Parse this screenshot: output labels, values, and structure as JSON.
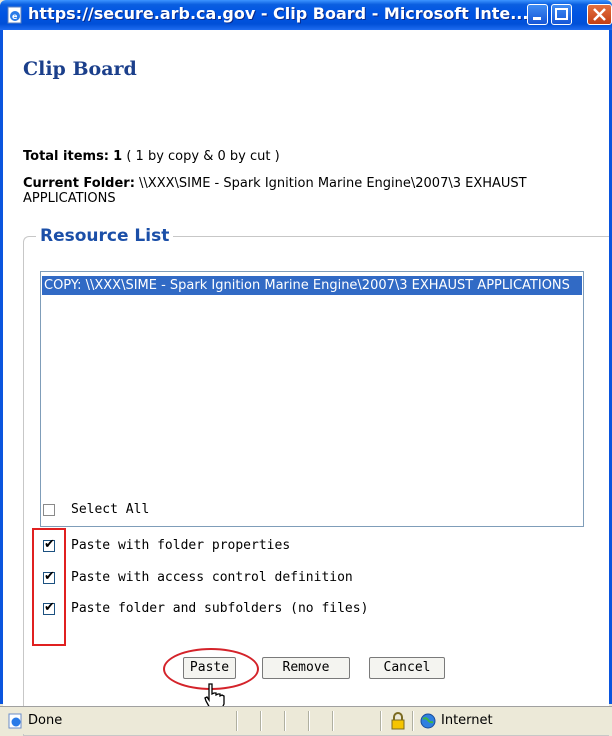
{
  "window": {
    "title": "https://secure.arb.ca.gov - Clip Board - Microsoft Inte...",
    "title_color": "#0054e3"
  },
  "page": {
    "title": "Clip Board",
    "total_label": "Total items:",
    "total_value": "1",
    "total_detail": " ( 1 by copy & 0 by cut )",
    "folder_label": "Current Folder:",
    "folder_path": " \\\\XXX\\SIME - Spark Ignition Marine Engine\\2007\\3 EXHAUST APPLICATIONS"
  },
  "resource_list": {
    "legend": "Resource List",
    "items": [
      "COPY:  \\\\XXX\\SIME - Spark Ignition Marine Engine\\2007\\3 EXHAUST APPLICATIONS"
    ],
    "selected_color": "#316ac5"
  },
  "options": {
    "select_all": {
      "label": "Select All",
      "checked": false
    },
    "paste_folder_properties": {
      "label": "Paste with folder properties",
      "checked": true
    },
    "paste_access_control": {
      "label": "Paste with access control definition",
      "checked": true
    },
    "paste_subfolders": {
      "label": "Paste folder and subfolders (no files)",
      "checked": true
    }
  },
  "buttons": {
    "paste": "Paste",
    "remove": "Remove",
    "cancel": "Cancel"
  },
  "annotations": {
    "highlight_color": "#e02020",
    "cursor_icon": "hand-pointer-icon"
  },
  "statusbar": {
    "status": "Done",
    "zone": "Internet",
    "lock_icon": "lock-icon",
    "zone_icon": "globe-icon"
  }
}
